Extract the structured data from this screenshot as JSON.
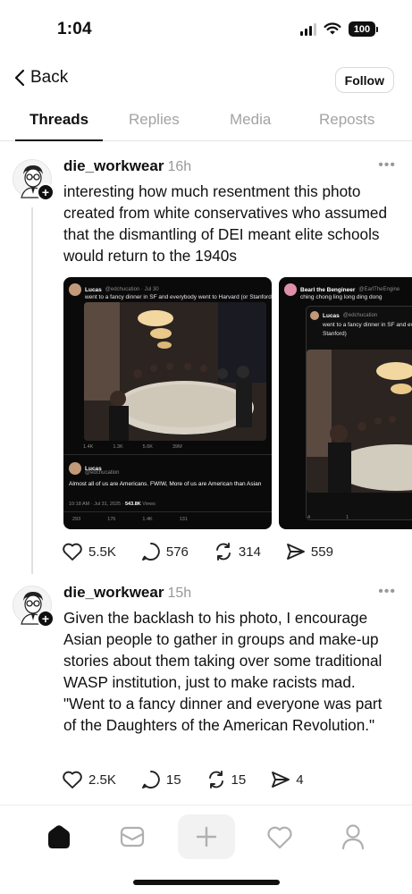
{
  "status_bar": {
    "time": "1:04",
    "battery": "100"
  },
  "nav": {
    "back_label": "Back",
    "follow_label": "Follow"
  },
  "tabs": [
    {
      "label": "Threads",
      "active": true
    },
    {
      "label": "Replies",
      "active": false
    },
    {
      "label": "Media",
      "active": false
    },
    {
      "label": "Reposts",
      "active": false
    }
  ],
  "posts": [
    {
      "username": "die_workwear",
      "time": "16h",
      "text": "interesting how much resentment this photo created from white conservatives who assumed that the dismantling of DEI meant elite schools would return to the 1940s",
      "media": [
        {
          "author": "Lucas",
          "handle": "@edchucation · Jul 30",
          "quoted_text": "went to a fancy dinner in SF and everybody went to Harvard (or Stanford)",
          "stats": [
            "1.4K",
            "1.3K",
            "5.6K",
            "39M"
          ],
          "reply_author": "Lucas",
          "reply_handle": "@edchucation",
          "reply_text": "Almost all of us are Americans. FWIW, More of us are American than Asian",
          "reply_date": "10:18 AM · Jul 31, 2025 ·",
          "reply_views": "543.8K",
          "reply_views_label": "Views",
          "reply_stats": [
            "293",
            "176",
            "1.4K",
            "131"
          ]
        },
        {
          "author": "Bearl the Bengineer",
          "handle": "@EarlTheEngine",
          "quoted_text": "ching chong ling long ding dong",
          "inner_author": "Lucas",
          "inner_handle": "@edchucation",
          "inner_text": "went to a fancy dinner in SF and ev",
          "inner_text2": "Stanford)",
          "stats": [
            "4",
            "1"
          ]
        }
      ],
      "actions": {
        "likes": "5.5K",
        "replies": "576",
        "reposts": "314",
        "shares": "559"
      }
    },
    {
      "username": "die_workwear",
      "time": "15h",
      "text": "Given the backlash to his photo, I encourage Asian people to gather in groups and make-up stories about them taking over some traditional WASP institution, just to make racists mad. \"Went to a fancy dinner and everyone was part of the Daughters of the American Revolution.\"",
      "actions": {
        "likes": "2.5K",
        "replies": "15",
        "reposts": "15",
        "shares": "4"
      }
    }
  ],
  "colors": {
    "text": "#101010",
    "muted": "#999999",
    "tab_inactive": "#a3a3a3",
    "border": "#e5e5e5",
    "media_bg": "#0a0a0a"
  },
  "bottom_nav": [
    "home-icon",
    "inbox-icon",
    "compose-icon",
    "activity-icon",
    "profile-icon"
  ]
}
